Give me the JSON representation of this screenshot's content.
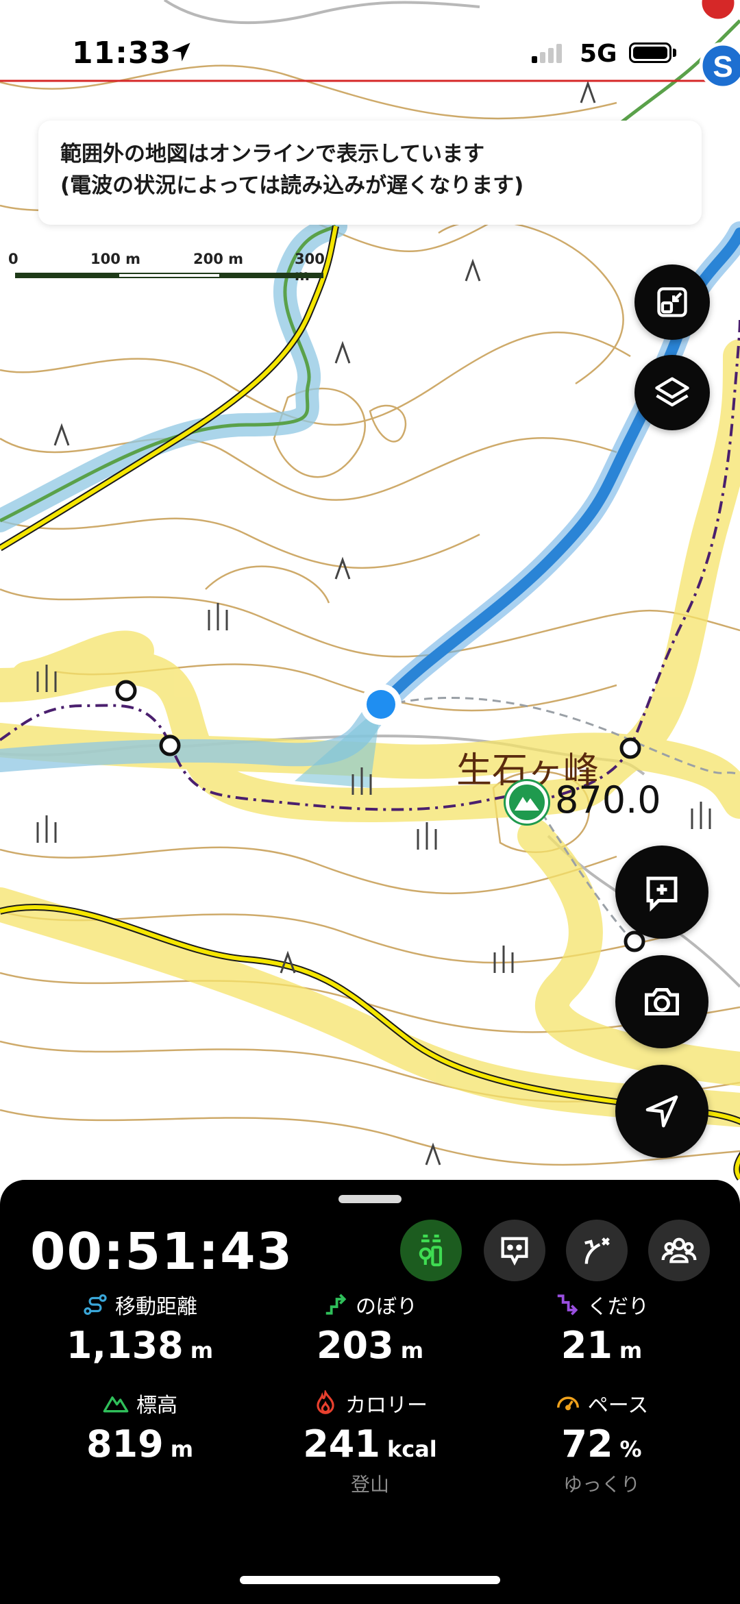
{
  "status_bar": {
    "time": "11:33",
    "network": "5G"
  },
  "banner": {
    "line1": "範囲外の地図はオンラインで表示しています",
    "line2": "(電波の状況によっては読み込みが遅くなります)"
  },
  "map": {
    "scale": {
      "labels": [
        "0",
        "100 m",
        "200 m",
        "300 m"
      ]
    },
    "summit": {
      "name": "生石ヶ峰",
      "elevation": "870.0"
    },
    "icons": {
      "fullscreen": "fullscreen-exit-icon",
      "layers": "layers-icon",
      "memo": "add-memo-icon",
      "camera": "camera-icon",
      "locate": "navigation-arrow-icon"
    }
  },
  "panel": {
    "elapsed_time": "00:51:43",
    "modes": [
      "climb-mode-icon",
      "chat-icon",
      "route-icon",
      "group-icon"
    ],
    "stats": [
      {
        "label": "移動距離",
        "value": "1,138",
        "unit": "m",
        "icon": "distance-icon",
        "color": "#3aa6d8"
      },
      {
        "label": "のぼり",
        "value": "203",
        "unit": "m",
        "icon": "ascent-icon",
        "color": "#2fbf5a"
      },
      {
        "label": "くだり",
        "value": "21",
        "unit": "m",
        "icon": "descent-icon",
        "color": "#9a4fe0"
      },
      {
        "label": "標高",
        "value": "819",
        "unit": "m",
        "icon": "mountain-icon",
        "color": "#2fbf5a"
      },
      {
        "label": "カロリー",
        "value": "241",
        "unit": "kcal",
        "sub": "登山",
        "icon": "fire-icon",
        "color": "#e8402e"
      },
      {
        "label": "ペース",
        "value": "72",
        "unit": "%",
        "sub": "ゆっくり",
        "icon": "gauge-icon",
        "color": "#f0a21c"
      }
    ]
  }
}
